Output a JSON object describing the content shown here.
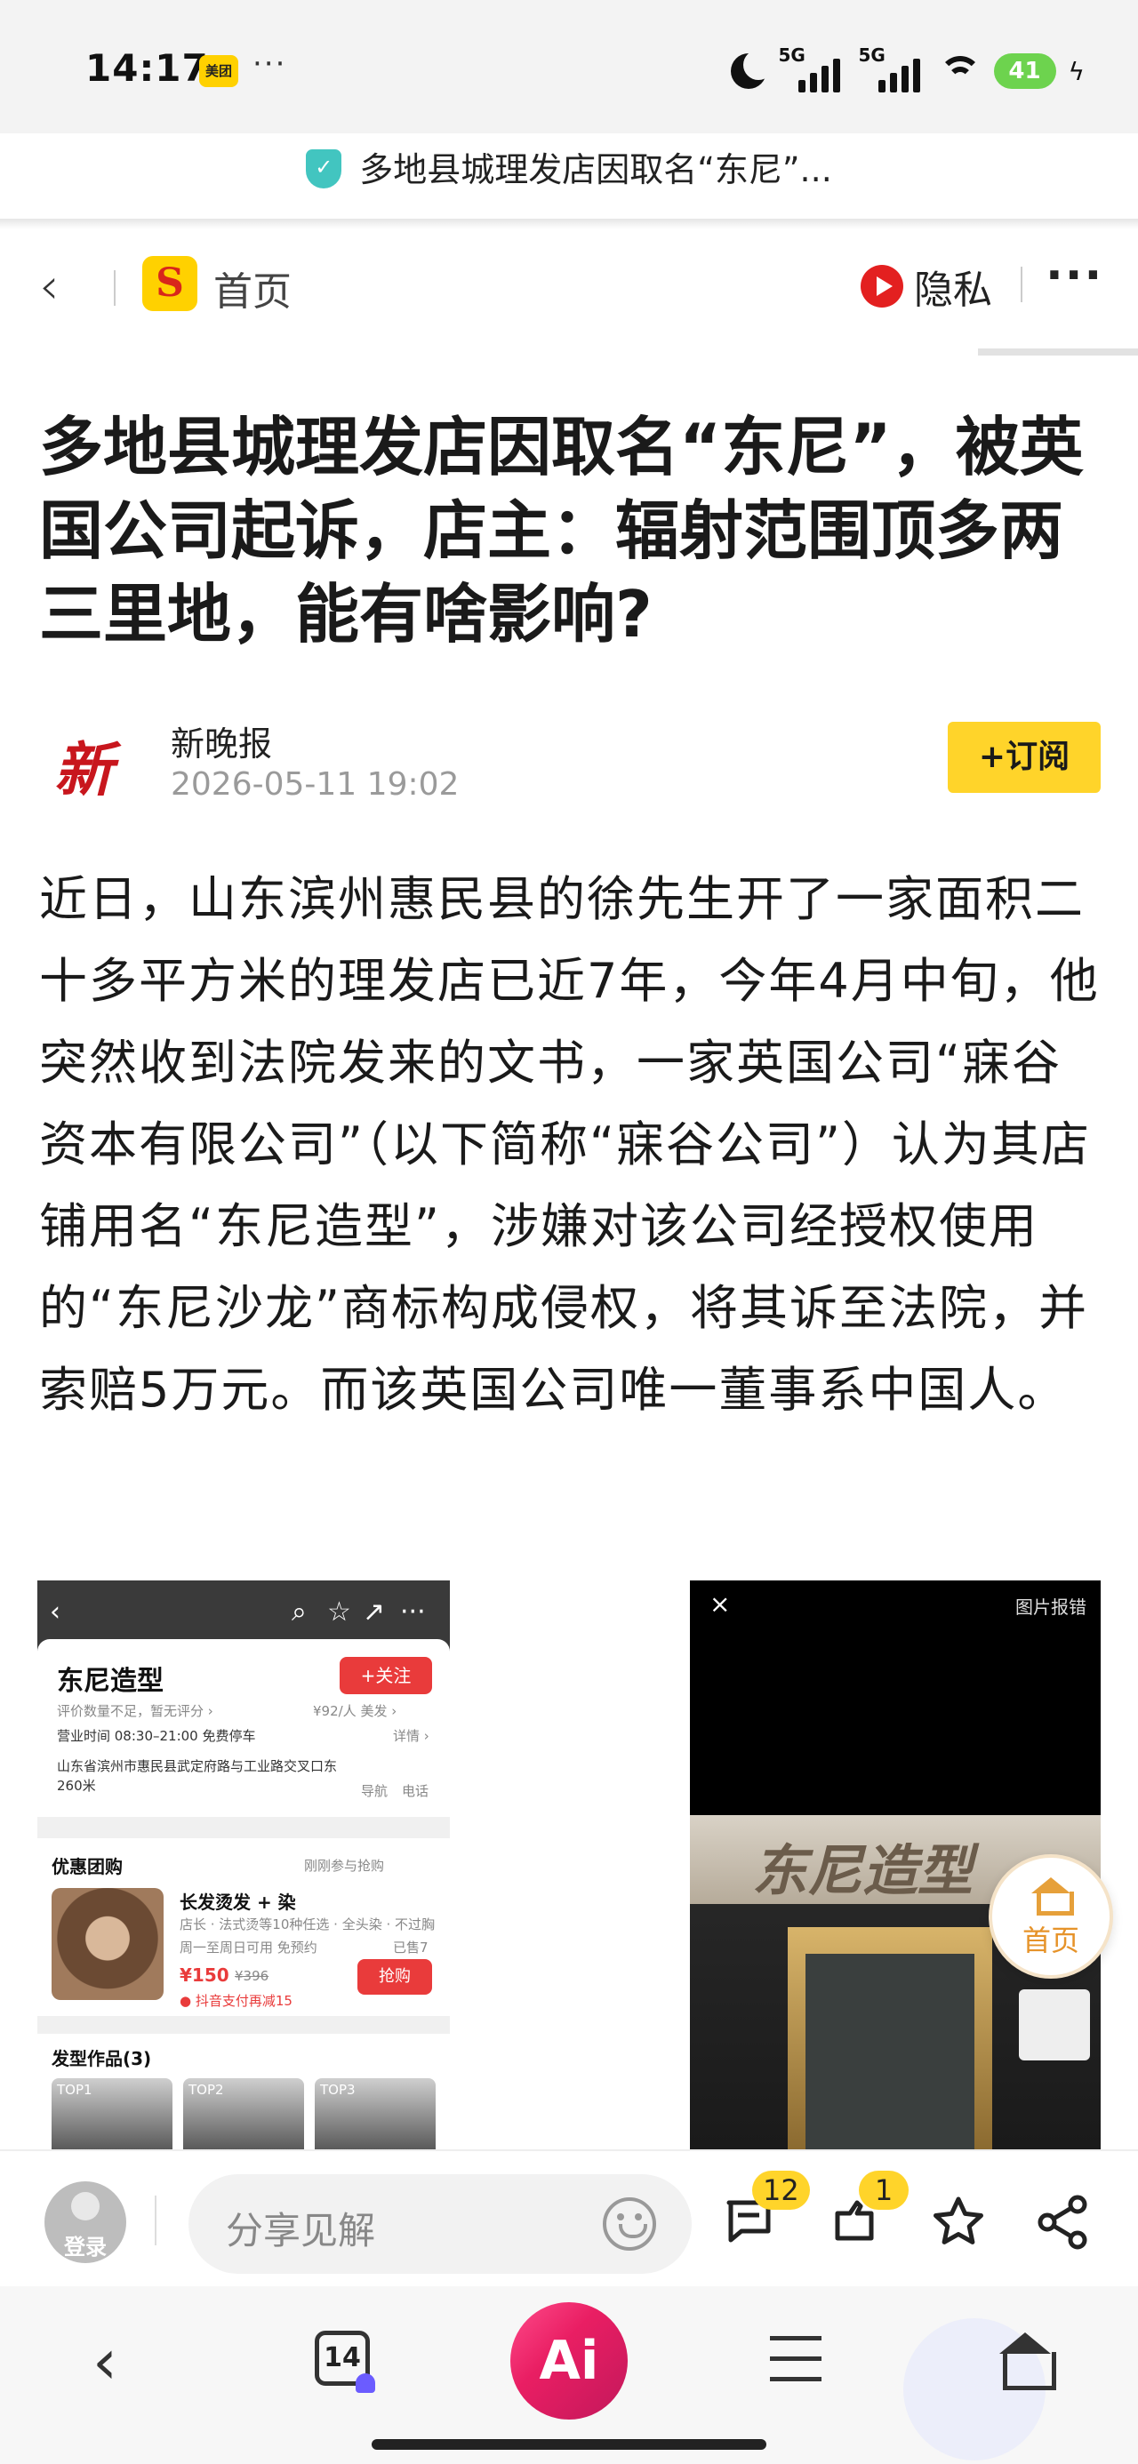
{
  "status_bar": {
    "time": "14:17",
    "app_badge": "美团",
    "more": "···",
    "signal1": "5G",
    "signal2": "5G",
    "battery": "41"
  },
  "url_bar": {
    "title": "多地县城理发店因取名“东尼”..."
  },
  "nav": {
    "back": "‹",
    "logo_letter": "S",
    "home_label": "首页",
    "privacy_label": "隐私",
    "more": "···"
  },
  "article": {
    "title": "多地县城理发店因取名“东尼”，被英国公司起诉，店主：辐射范围顶多两三里地，能有啥影响?",
    "author": "新晚报",
    "author_logo": "新",
    "date": "2026-05-11 19:02",
    "subscribe_label": "+订阅",
    "body": "近日，山东滨州惠民县的徐先生开了一家面积二十多平方米的理发店已近7年，今年4月中旬，他突然收到法院发来的文书，一家英国公司“寐谷资本有限公司”（以下简称“寐谷公司”）认为其店铺用名“东尼造型”，涉嫌对该公司经授权使用的“东尼沙龙”商标构成侵权，将其诉至法院，并索赔5万元。而该英国公司唯一董事系中国人。"
  },
  "left_image": {
    "shop_name": "东尼造型",
    "follow": "+关注",
    "rating": "评价数量不足，暂无评分 ›",
    "price_per": "¥92/人  美发 ›",
    "hours": "营业时间 08:30–21:00  免费停车",
    "detail": "详情 ›",
    "address": "山东省滨州市惠民县武定府路与工业路交叉口东 260米",
    "nav_label": "导航",
    "phone_label": "电话",
    "deals_title": "优惠团购",
    "deals_note": "刚刚参与抢购",
    "deal_name": "长发烫发 + 染",
    "deal_desc": "店长 · 法式烫等10种任选 · 全头染 · 不过胸",
    "deal_tags": "周一至周日可用  免预约",
    "deal_sold": "已售7",
    "deal_price": "¥150",
    "deal_orig": "¥396",
    "deal_promo": "● 抖音支付再减15",
    "buy": "抢购",
    "works_title": "发型作品(3)",
    "top_labels": [
      "TOP1",
      "TOP2",
      "TOP3"
    ]
  },
  "right_image": {
    "close": "×",
    "report": "图片报错",
    "sign_text": "东尼造型"
  },
  "float_home": {
    "label": "首页"
  },
  "comment_bar": {
    "login": "登录",
    "placeholder": "分享见解",
    "comments_count": "12",
    "shares_count": "1"
  },
  "bottom_nav": {
    "back": "‹",
    "tabs_count": "14",
    "ai_label": "Ai"
  },
  "colors": {
    "accent_yellow": "#ffd42a",
    "brand_red": "#e32020",
    "ai_pink": "#e91e63"
  }
}
